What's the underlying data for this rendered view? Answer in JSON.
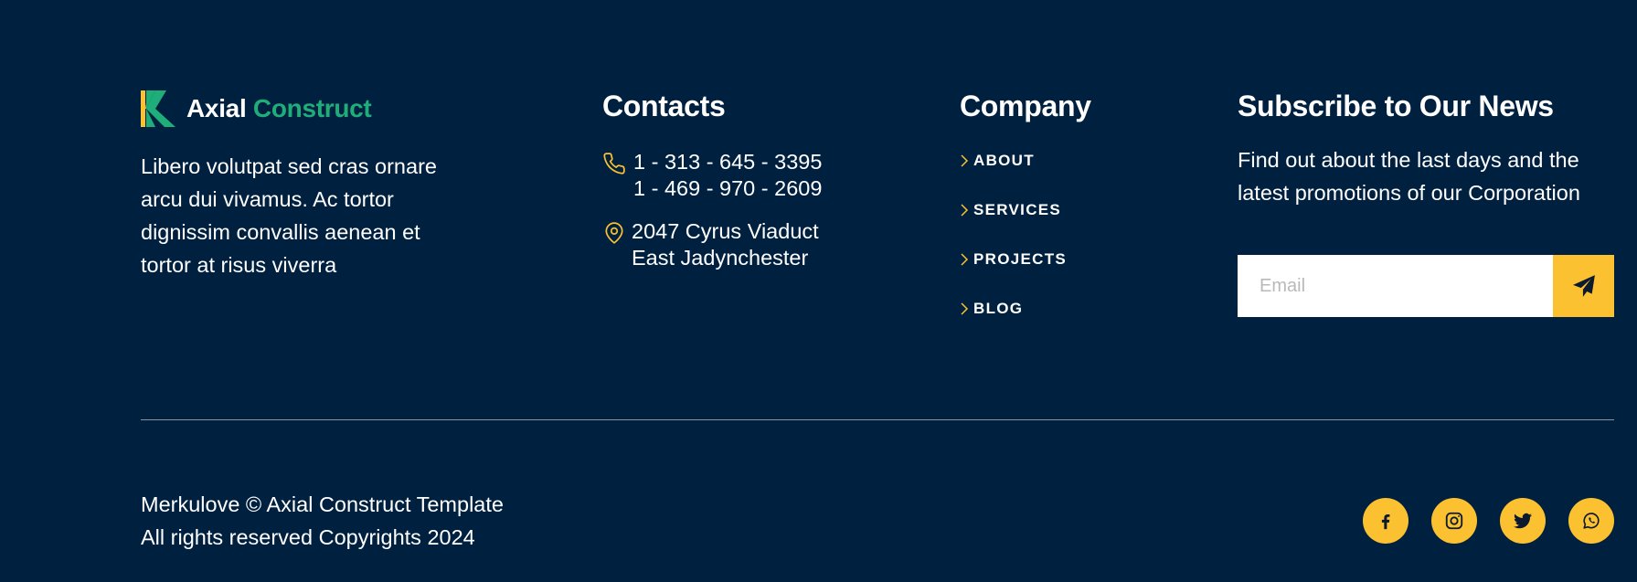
{
  "brand": {
    "name_part1": "Axial",
    "name_part2": "Construct",
    "description": "Libero volutpat sed cras ornare arcu dui vivamus. Ac tortor dignissim convallis aenean et tortor at risus viverra",
    "accent_color": "#1fae7a",
    "logo_icon": "double-chevron-k-logo-icon"
  },
  "contacts": {
    "title": "Contacts",
    "phone_1": "1 - 313 - 645 - 3395",
    "phone_2": "1 - 469 - 970 - 2609",
    "address_1": "2047 Cyrus Viaduct",
    "address_2": "East Jadynchester",
    "phone_icon": "phone-icon",
    "address_icon": "map-pin-icon"
  },
  "company": {
    "title": "Company",
    "links": [
      {
        "label": "ABOUT"
      },
      {
        "label": "SERVICES"
      },
      {
        "label": "PROJECTS"
      },
      {
        "label": "BLOG"
      }
    ]
  },
  "subscribe": {
    "title": "Subscribe to Our News",
    "description": "Find out about the last days and the latest promotions of our Corporation",
    "email_placeholder": "Email",
    "email_value": "",
    "send_icon": "paper-plane-icon"
  },
  "bottom": {
    "copyright_line1": "Merkulove © Axial Construct Template",
    "copyright_line2": "All rights reserved Copyrights 2024",
    "socials": [
      "facebook-icon",
      "instagram-icon",
      "twitter-icon",
      "whatsapp-icon"
    ]
  },
  "colors": {
    "background": "#002040",
    "accent_yellow": "#fbc130",
    "text": "#ffffff"
  }
}
